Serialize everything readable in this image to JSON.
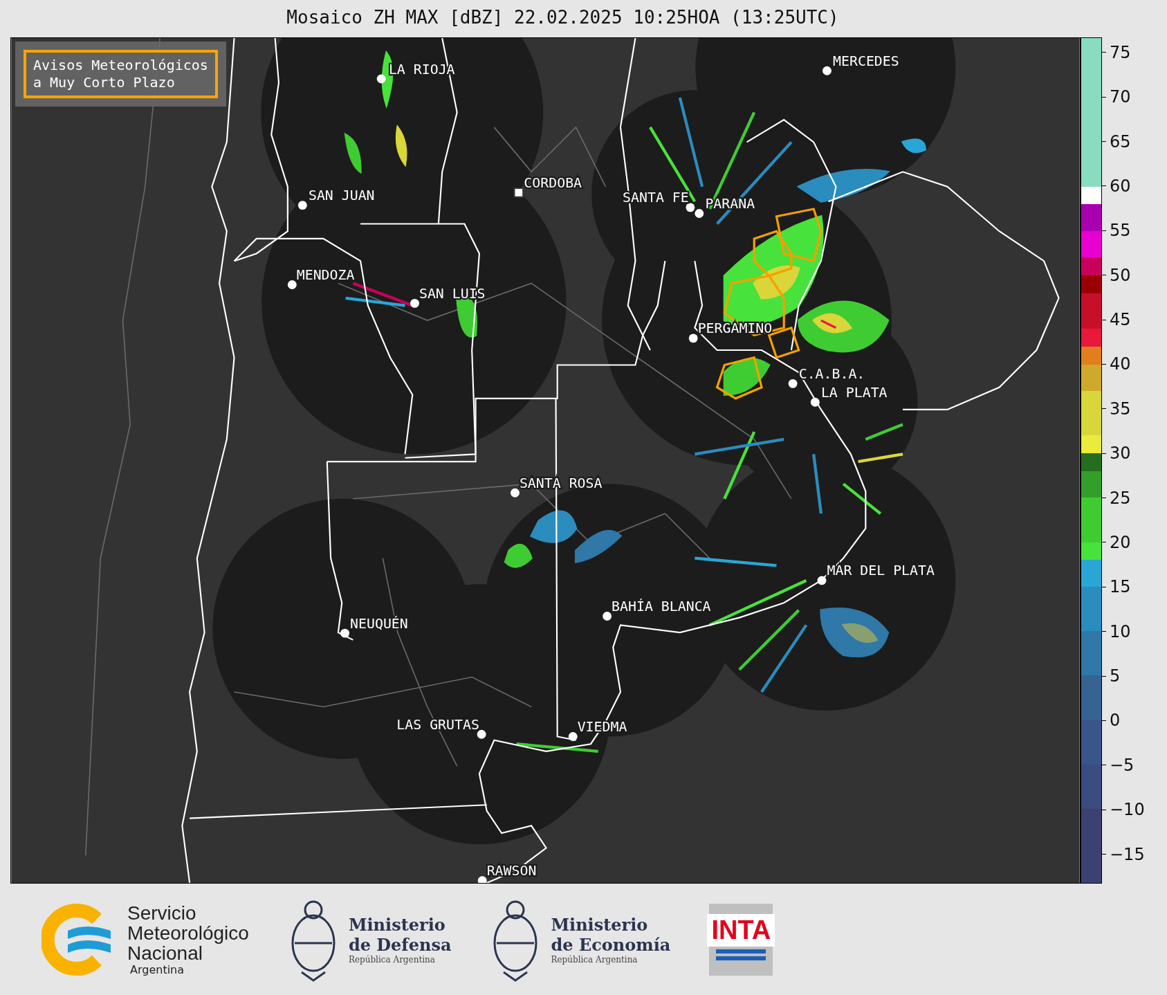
{
  "title": "Mosaico ZH MAX [dBZ] 22.02.2025 10:25HOA (13:25UTC)",
  "legend": "Avisos Meteorológicos\na Muy Corto Plazo",
  "cities": [
    {
      "name": "MERCEDES",
      "kind": "dot"
    },
    {
      "name": "LA RIOJA",
      "kind": "dot"
    },
    {
      "name": "CORDOBA",
      "kind": "square"
    },
    {
      "name": "SAN JUAN",
      "kind": "dot"
    },
    {
      "name": "SANTA FE",
      "kind": "dot"
    },
    {
      "name": "PARANA",
      "kind": "dot"
    },
    {
      "name": "MENDOZA",
      "kind": "dot"
    },
    {
      "name": "SAN LUIS",
      "kind": "dot"
    },
    {
      "name": "PERGAMINO",
      "kind": "dot"
    },
    {
      "name": "C.A.B.A.",
      "kind": "dot"
    },
    {
      "name": "LA PLATA",
      "kind": "dot"
    },
    {
      "name": "SANTA ROSA",
      "kind": "dot"
    },
    {
      "name": "MAR DEL PLATA",
      "kind": "dot"
    },
    {
      "name": "BAHÍA BLANCA",
      "kind": "dot"
    },
    {
      "name": "NEUQUÉN",
      "kind": "dot"
    },
    {
      "name": "LAS GRUTAS",
      "kind": "dot"
    },
    {
      "name": "VIEDMA",
      "kind": "dot"
    },
    {
      "name": "RAWSON",
      "kind": "dot"
    }
  ],
  "colorbar": {
    "ticks": [
      "75",
      "70",
      "65",
      "60",
      "55",
      "50",
      "45",
      "40",
      "35",
      "30",
      "25",
      "20",
      "15",
      "10",
      "5",
      "0",
      "−5",
      "−10",
      "−15"
    ]
  },
  "footer": {
    "smn": {
      "lines": [
        "Servicio",
        "Meteorológico",
        "Nacional"
      ],
      "country": "Argentina"
    },
    "ministries": [
      {
        "lines": [
          "Ministerio",
          "de Defensa"
        ],
        "country": "República Argentina"
      },
      {
        "lines": [
          "Ministerio",
          "de Economía"
        ],
        "country": "República Argentina"
      }
    ],
    "inta": "INTA"
  }
}
